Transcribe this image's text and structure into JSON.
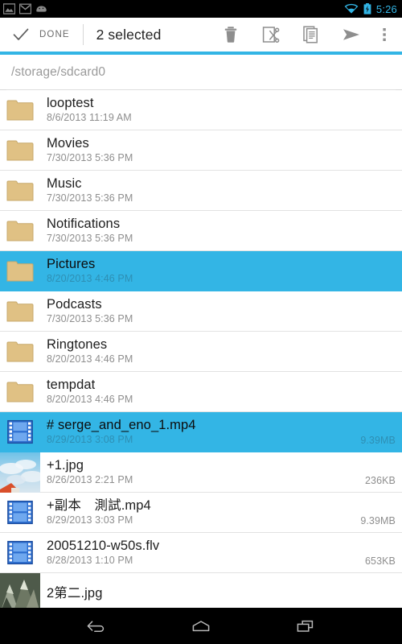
{
  "statusbar": {
    "left_icons": [
      "gallery-icon",
      "gmail-icon",
      "android-face-icon"
    ],
    "right_icons": [
      "wifi-icon",
      "battery-charging-icon"
    ],
    "clock": "5:26",
    "accent_color": "#33b5e5",
    "background": "#000000"
  },
  "actionbar": {
    "done_label": "DONE",
    "done_icon": "check-icon",
    "selection_label": "2 selected",
    "actions": [
      {
        "name": "delete-button",
        "icon": "trash-icon"
      },
      {
        "name": "cut-button",
        "icon": "scissors-icon"
      },
      {
        "name": "copy-button",
        "icon": "copy-icon"
      },
      {
        "name": "send-button",
        "icon": "send-icon"
      },
      {
        "name": "overflow-button",
        "icon": "overflow-menu-icon"
      }
    ],
    "accent_color": "#33b5e5"
  },
  "pathbar": {
    "path": "/storage/sdcard0",
    "placeholder": "/storage/sdcard0"
  },
  "files": [
    {
      "name": "looptest",
      "date": "8/6/2013 11:19 AM",
      "size": "",
      "type": "folder",
      "selected": false
    },
    {
      "name": "Movies",
      "date": "7/30/2013 5:36 PM",
      "size": "",
      "type": "folder",
      "selected": false
    },
    {
      "name": "Music",
      "date": "7/30/2013 5:36 PM",
      "size": "",
      "type": "folder",
      "selected": false
    },
    {
      "name": "Notifications",
      "date": "7/30/2013 5:36 PM",
      "size": "",
      "type": "folder",
      "selected": false
    },
    {
      "name": "Pictures",
      "date": "8/20/2013 4:46 PM",
      "size": "",
      "type": "folder",
      "selected": true
    },
    {
      "name": "Podcasts",
      "date": "7/30/2013 5:36 PM",
      "size": "",
      "type": "folder",
      "selected": false
    },
    {
      "name": "Ringtones",
      "date": "8/20/2013 4:46 PM",
      "size": "",
      "type": "folder",
      "selected": false
    },
    {
      "name": "tempdat",
      "date": "8/20/2013 4:46 PM",
      "size": "",
      "type": "folder",
      "selected": false
    },
    {
      "name": "# serge_and_eno_1.mp4",
      "date": "8/29/2013 3:08 PM",
      "size": "9.39MB",
      "type": "video",
      "selected": true
    },
    {
      "name": "+1.jpg",
      "date": "8/26/2013 2:21 PM",
      "size": "236KB",
      "type": "image-sky",
      "selected": false
    },
    {
      "name": "+副本　測試.mp4",
      "date": "8/29/2013 3:03 PM",
      "size": "9.39MB",
      "type": "video",
      "selected": false
    },
    {
      "name": "20051210-w50s.flv",
      "date": "8/28/2013 1:10 PM",
      "size": "653KB",
      "type": "video",
      "selected": false
    },
    {
      "name": "2第二.jpg",
      "date": "",
      "size": "",
      "type": "image-mountain",
      "selected": false
    }
  ],
  "navbar": {
    "buttons": [
      {
        "name": "nav-back-button",
        "icon": "back-arrow-icon"
      },
      {
        "name": "nav-home-button",
        "icon": "home-icon"
      },
      {
        "name": "nav-recents-button",
        "icon": "recents-icon"
      }
    ]
  },
  "colors": {
    "accent": "#33b5e5",
    "folder": "#e0c184",
    "text_primary": "#1d1d1d",
    "text_secondary": "#8e8e8e"
  }
}
